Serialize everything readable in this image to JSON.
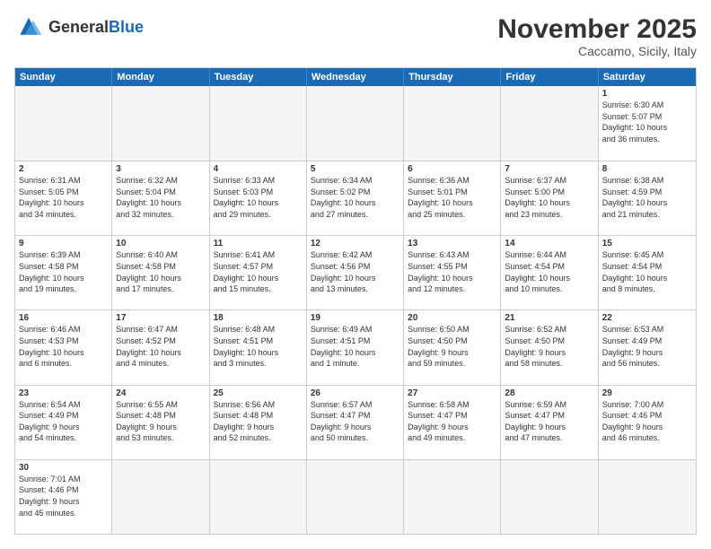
{
  "header": {
    "logo_general": "General",
    "logo_blue": "Blue",
    "month_year": "November 2025",
    "location": "Caccamo, Sicily, Italy"
  },
  "days_of_week": [
    "Sunday",
    "Monday",
    "Tuesday",
    "Wednesday",
    "Thursday",
    "Friday",
    "Saturday"
  ],
  "rows": [
    [
      {
        "day": "",
        "info": "",
        "empty": true
      },
      {
        "day": "",
        "info": "",
        "empty": true
      },
      {
        "day": "",
        "info": "",
        "empty": true
      },
      {
        "day": "",
        "info": "",
        "empty": true
      },
      {
        "day": "",
        "info": "",
        "empty": true
      },
      {
        "day": "",
        "info": "",
        "empty": true
      },
      {
        "day": "1",
        "info": "Sunrise: 6:30 AM\nSunset: 5:07 PM\nDaylight: 10 hours\nand 36 minutes.",
        "empty": false
      }
    ],
    [
      {
        "day": "2",
        "info": "Sunrise: 6:31 AM\nSunset: 5:05 PM\nDaylight: 10 hours\nand 34 minutes.",
        "empty": false
      },
      {
        "day": "3",
        "info": "Sunrise: 6:32 AM\nSunset: 5:04 PM\nDaylight: 10 hours\nand 32 minutes.",
        "empty": false
      },
      {
        "day": "4",
        "info": "Sunrise: 6:33 AM\nSunset: 5:03 PM\nDaylight: 10 hours\nand 29 minutes.",
        "empty": false
      },
      {
        "day": "5",
        "info": "Sunrise: 6:34 AM\nSunset: 5:02 PM\nDaylight: 10 hours\nand 27 minutes.",
        "empty": false
      },
      {
        "day": "6",
        "info": "Sunrise: 6:36 AM\nSunset: 5:01 PM\nDaylight: 10 hours\nand 25 minutes.",
        "empty": false
      },
      {
        "day": "7",
        "info": "Sunrise: 6:37 AM\nSunset: 5:00 PM\nDaylight: 10 hours\nand 23 minutes.",
        "empty": false
      },
      {
        "day": "8",
        "info": "Sunrise: 6:38 AM\nSunset: 4:59 PM\nDaylight: 10 hours\nand 21 minutes.",
        "empty": false
      }
    ],
    [
      {
        "day": "9",
        "info": "Sunrise: 6:39 AM\nSunset: 4:58 PM\nDaylight: 10 hours\nand 19 minutes.",
        "empty": false
      },
      {
        "day": "10",
        "info": "Sunrise: 6:40 AM\nSunset: 4:58 PM\nDaylight: 10 hours\nand 17 minutes.",
        "empty": false
      },
      {
        "day": "11",
        "info": "Sunrise: 6:41 AM\nSunset: 4:57 PM\nDaylight: 10 hours\nand 15 minutes.",
        "empty": false
      },
      {
        "day": "12",
        "info": "Sunrise: 6:42 AM\nSunset: 4:56 PM\nDaylight: 10 hours\nand 13 minutes.",
        "empty": false
      },
      {
        "day": "13",
        "info": "Sunrise: 6:43 AM\nSunset: 4:55 PM\nDaylight: 10 hours\nand 12 minutes.",
        "empty": false
      },
      {
        "day": "14",
        "info": "Sunrise: 6:44 AM\nSunset: 4:54 PM\nDaylight: 10 hours\nand 10 minutes.",
        "empty": false
      },
      {
        "day": "15",
        "info": "Sunrise: 6:45 AM\nSunset: 4:54 PM\nDaylight: 10 hours\nand 8 minutes.",
        "empty": false
      }
    ],
    [
      {
        "day": "16",
        "info": "Sunrise: 6:46 AM\nSunset: 4:53 PM\nDaylight: 10 hours\nand 6 minutes.",
        "empty": false
      },
      {
        "day": "17",
        "info": "Sunrise: 6:47 AM\nSunset: 4:52 PM\nDaylight: 10 hours\nand 4 minutes.",
        "empty": false
      },
      {
        "day": "18",
        "info": "Sunrise: 6:48 AM\nSunset: 4:51 PM\nDaylight: 10 hours\nand 3 minutes.",
        "empty": false
      },
      {
        "day": "19",
        "info": "Sunrise: 6:49 AM\nSunset: 4:51 PM\nDaylight: 10 hours\nand 1 minute.",
        "empty": false
      },
      {
        "day": "20",
        "info": "Sunrise: 6:50 AM\nSunset: 4:50 PM\nDaylight: 9 hours\nand 59 minutes.",
        "empty": false
      },
      {
        "day": "21",
        "info": "Sunrise: 6:52 AM\nSunset: 4:50 PM\nDaylight: 9 hours\nand 58 minutes.",
        "empty": false
      },
      {
        "day": "22",
        "info": "Sunrise: 6:53 AM\nSunset: 4:49 PM\nDaylight: 9 hours\nand 56 minutes.",
        "empty": false
      }
    ],
    [
      {
        "day": "23",
        "info": "Sunrise: 6:54 AM\nSunset: 4:49 PM\nDaylight: 9 hours\nand 54 minutes.",
        "empty": false
      },
      {
        "day": "24",
        "info": "Sunrise: 6:55 AM\nSunset: 4:48 PM\nDaylight: 9 hours\nand 53 minutes.",
        "empty": false
      },
      {
        "day": "25",
        "info": "Sunrise: 6:56 AM\nSunset: 4:48 PM\nDaylight: 9 hours\nand 52 minutes.",
        "empty": false
      },
      {
        "day": "26",
        "info": "Sunrise: 6:57 AM\nSunset: 4:47 PM\nDaylight: 9 hours\nand 50 minutes.",
        "empty": false
      },
      {
        "day": "27",
        "info": "Sunrise: 6:58 AM\nSunset: 4:47 PM\nDaylight: 9 hours\nand 49 minutes.",
        "empty": false
      },
      {
        "day": "28",
        "info": "Sunrise: 6:59 AM\nSunset: 4:47 PM\nDaylight: 9 hours\nand 47 minutes.",
        "empty": false
      },
      {
        "day": "29",
        "info": "Sunrise: 7:00 AM\nSunset: 4:46 PM\nDaylight: 9 hours\nand 46 minutes.",
        "empty": false
      }
    ],
    [
      {
        "day": "30",
        "info": "Sunrise: 7:01 AM\nSunset: 4:46 PM\nDaylight: 9 hours\nand 45 minutes.",
        "empty": false
      },
      {
        "day": "",
        "info": "",
        "empty": true
      },
      {
        "day": "",
        "info": "",
        "empty": true
      },
      {
        "day": "",
        "info": "",
        "empty": true
      },
      {
        "day": "",
        "info": "",
        "empty": true
      },
      {
        "day": "",
        "info": "",
        "empty": true
      },
      {
        "day": "",
        "info": "",
        "empty": true
      }
    ]
  ]
}
